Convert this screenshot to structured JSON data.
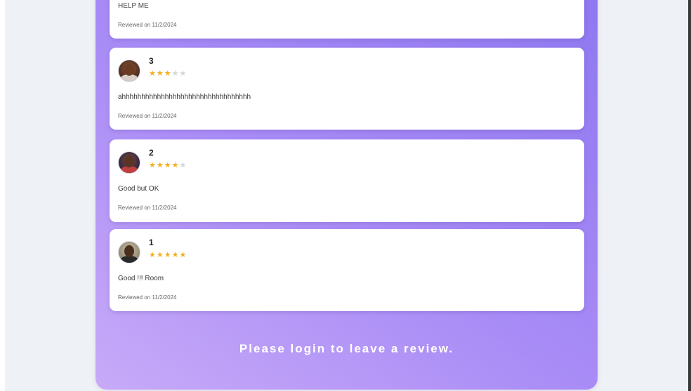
{
  "reviews": [
    {
      "name": "",
      "rating": 0,
      "comment": "HELP ME",
      "date": "Reviewed on 11/2/2024"
    },
    {
      "name": "3",
      "rating": 3,
      "comment": "ahhhhhhhhhhhhhhhhhhhhhhhhhhhhhhhhh",
      "date": "Reviewed on 11/2/2024"
    },
    {
      "name": "2",
      "rating": 4,
      "comment": "Good but OK",
      "date": "Reviewed on 11/2/2024"
    },
    {
      "name": "1",
      "rating": 5,
      "comment": "Good !!! Room",
      "date": "Reviewed on 11/2/2024"
    }
  ],
  "login_prompt": "Please login to leave a review.",
  "colors": {
    "star_filled": "#f2b01e",
    "star_empty": "#d6d6de",
    "panel_gradient_start": "#c8aaf8",
    "panel_gradient_end": "#8e77f0"
  },
  "icons": {
    "star": "star-icon",
    "avatar": "avatar"
  }
}
